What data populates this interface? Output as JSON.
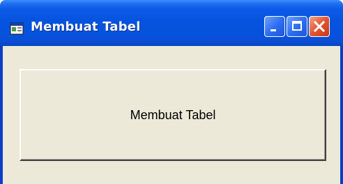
{
  "window": {
    "title": "Membuat Tabel",
    "icon": "vb-form-icon"
  },
  "title_buttons": {
    "minimize_icon": "minimize-icon",
    "maximize_icon": "maximize-icon",
    "close_icon": "close-icon"
  },
  "content": {
    "button_label": "Membuat Tabel"
  },
  "colors": {
    "titlebar": "#0654de",
    "client": "#ece9d8",
    "close": "#e2552f"
  }
}
